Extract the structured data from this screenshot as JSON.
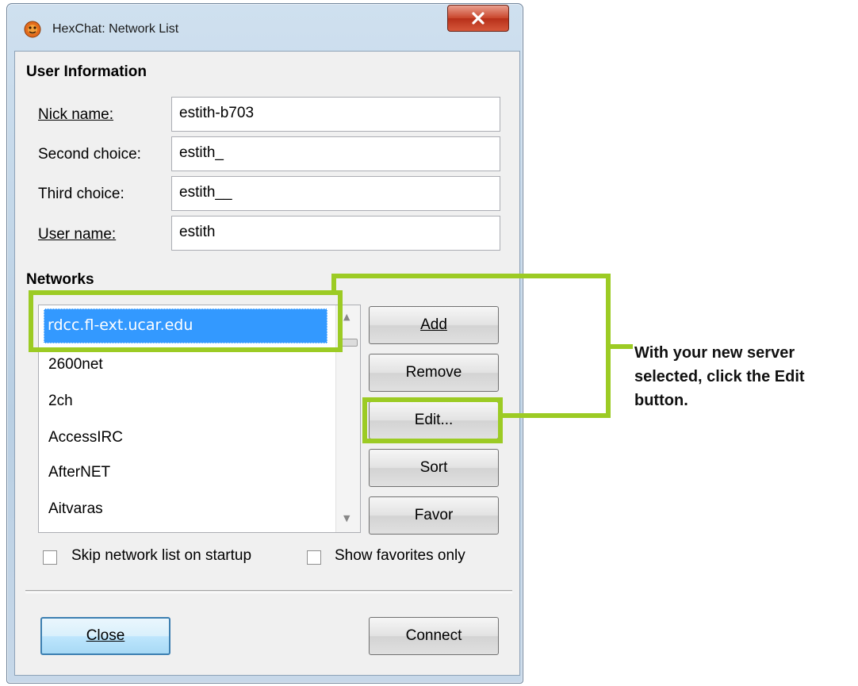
{
  "window": {
    "title": "HexChat: Network List",
    "close_glyph": "x"
  },
  "user_info": {
    "heading": "User Information",
    "nick_label": "Nick name:",
    "nick_value": "estith-b703",
    "second_label": "Second choice:",
    "second_value": "estith_",
    "third_label": "Third choice:",
    "third_value": "estith__",
    "user_label": "User name:",
    "user_value": "estith"
  },
  "networks": {
    "heading": "Networks",
    "items": [
      "rdcc.fl-ext.ucar.edu",
      "2600net",
      "2ch",
      "AccessIRC",
      "AfterNET",
      "Aitvaras"
    ],
    "selected": "rdcc.fl-ext.ucar.edu",
    "buttons": {
      "add": "Add",
      "remove": "Remove",
      "edit": "Edit...",
      "sort": "Sort",
      "favor": "Favor"
    }
  },
  "options": {
    "skip_label": "Skip network list on startup",
    "skip_checked": false,
    "favorites_label": "Show favorites only",
    "favorites_checked": false
  },
  "footer": {
    "close_label": "Close",
    "connect_label": "Connect"
  },
  "annotation": {
    "text": "With your new server selected, click the Edit button.",
    "color": "#9ccb24"
  }
}
